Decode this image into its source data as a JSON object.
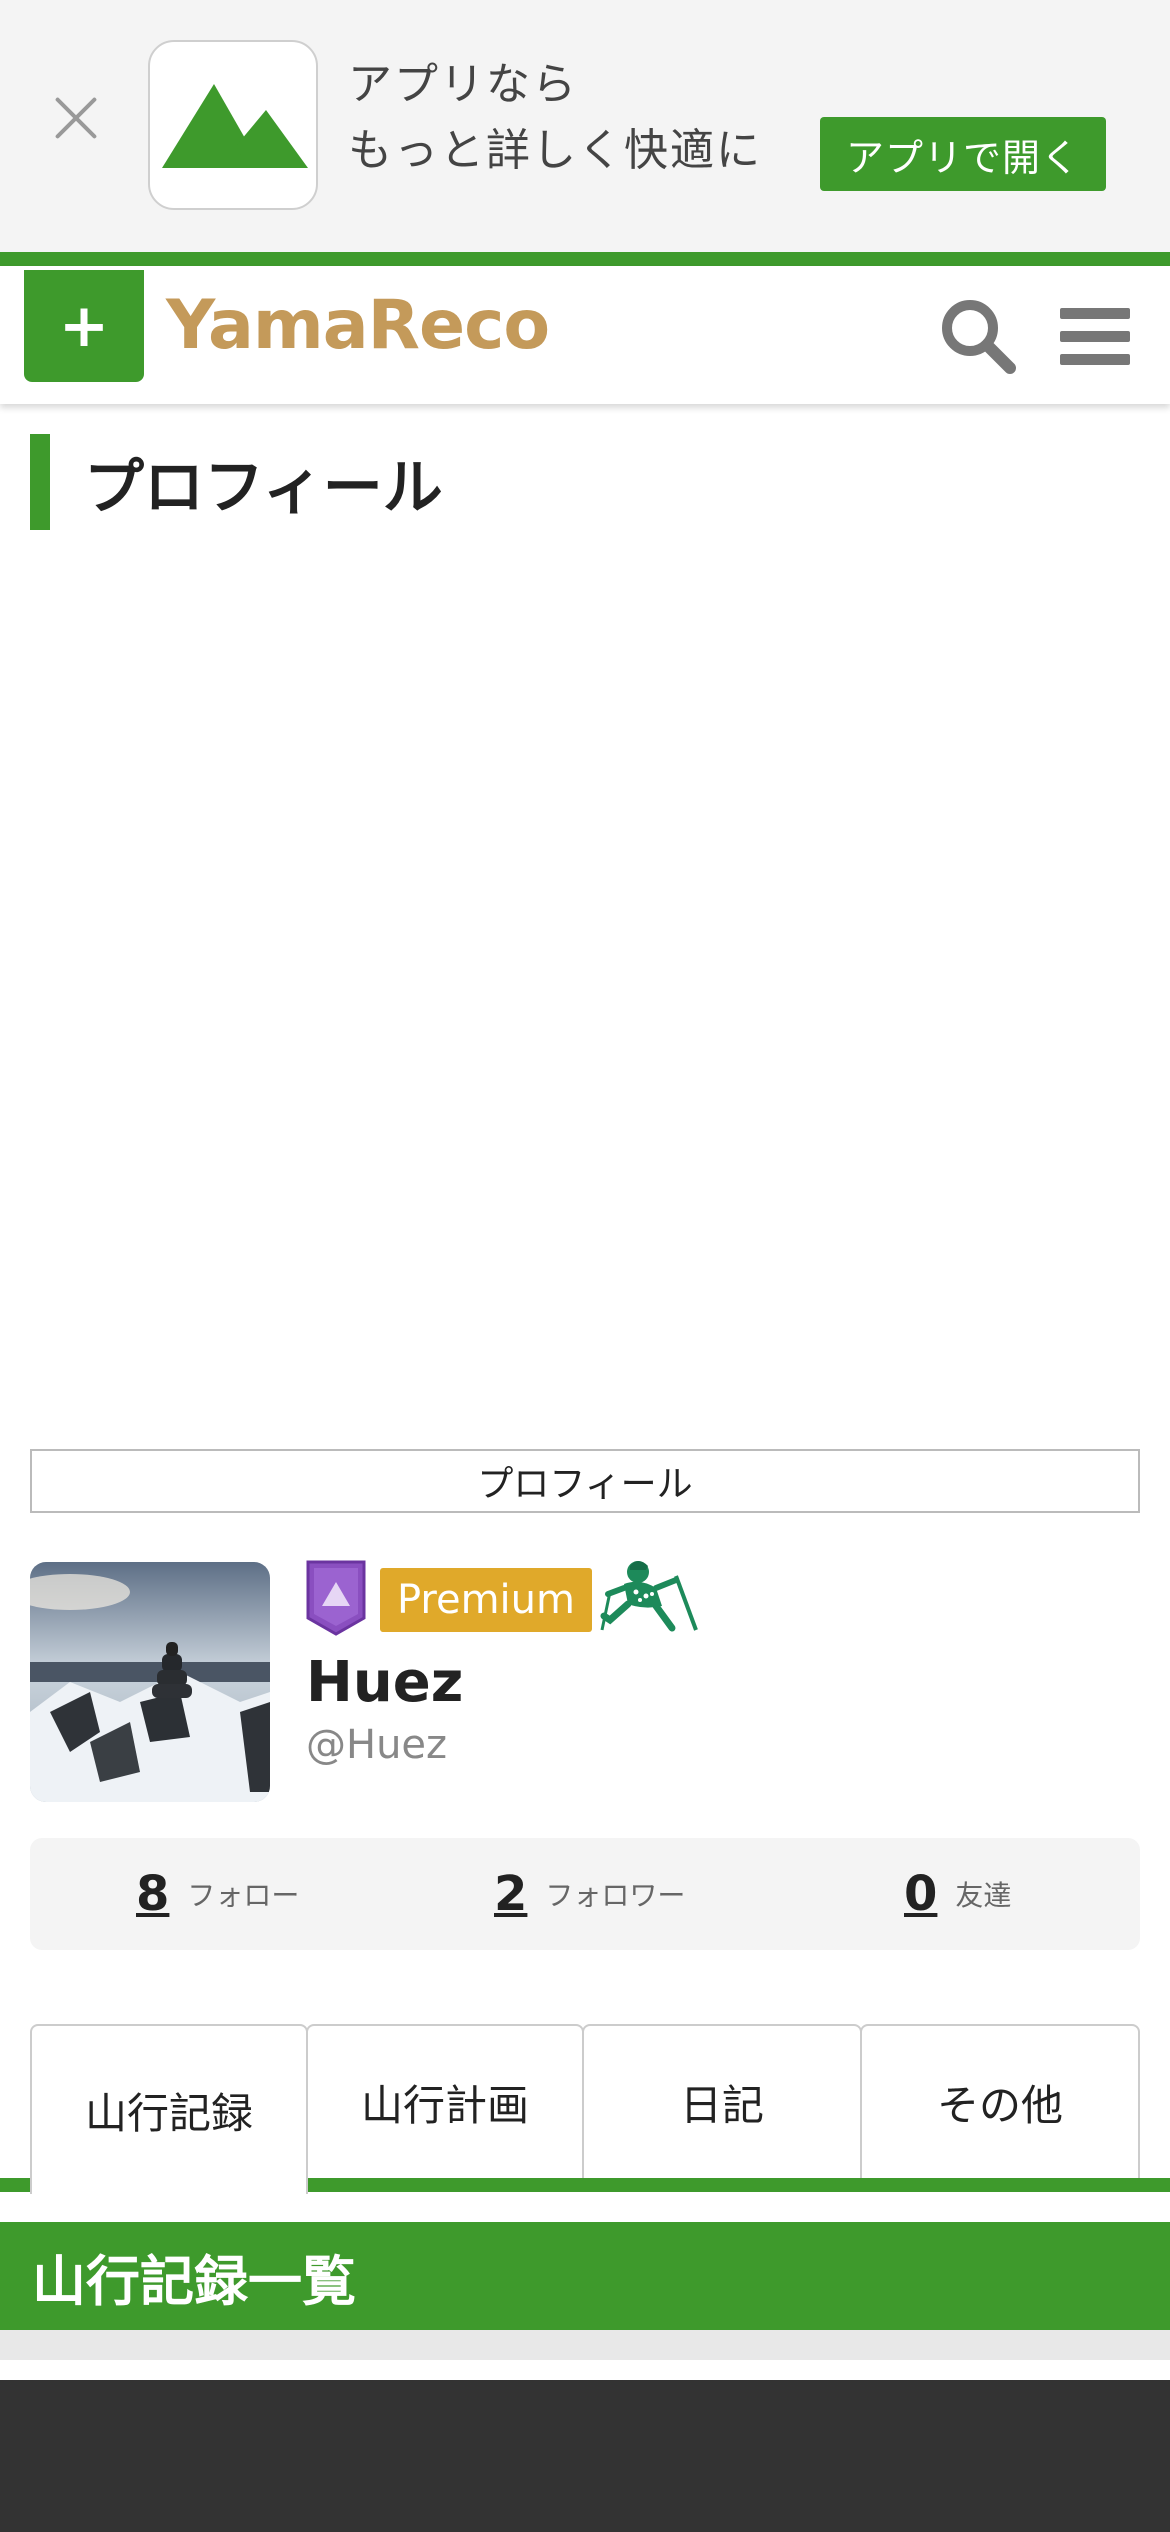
{
  "banner": {
    "line1": "アプリなら",
    "line2": "もっと詳しく快適に",
    "open_button": "アプリで開く"
  },
  "header": {
    "add_label": "+",
    "logo": "YamaReco"
  },
  "page": {
    "title": "プロフィール",
    "profile_tab": "プロフィール"
  },
  "profile": {
    "premium": "Premium",
    "name": "Huez",
    "handle": "@Huez"
  },
  "stats": [
    {
      "value": "8",
      "label": "フォロー"
    },
    {
      "value": "2",
      "label": "フォロワー"
    },
    {
      "value": "0",
      "label": "友達"
    }
  ],
  "tabs": [
    {
      "label": "山行記録",
      "active": true
    },
    {
      "label": "山行計画",
      "active": false
    },
    {
      "label": "日記",
      "active": false
    },
    {
      "label": "その他",
      "active": false
    }
  ],
  "section": {
    "title": "山行記録一覧"
  },
  "colors": {
    "brand_green": "#3e9a2c",
    "premium_gold": "#e0a92a",
    "logo_tan": "#c49a5a",
    "badge_purple": "#8a4fc0"
  },
  "icons": [
    "close-icon",
    "mountain-app-icon",
    "plus-icon",
    "search-icon",
    "menu-icon",
    "shield-badge-icon",
    "hiker-icon"
  ]
}
